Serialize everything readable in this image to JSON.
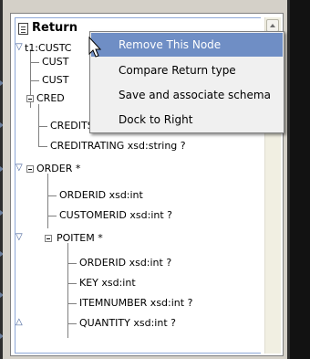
{
  "header": {
    "title": "Return",
    "icon": "document-icon"
  },
  "tree": [
    {
      "label": "t1:CUSTC",
      "expander": "glyph"
    },
    {
      "label": "CUST"
    },
    {
      "label": "CUST"
    },
    {
      "label": "CRED",
      "expander": "box"
    },
    {
      "label": "CREDITSCORE  xsd:int ?"
    },
    {
      "label": "CREDITRATING  xsd:string ?"
    },
    {
      "label": "ORDER *",
      "expander": "both"
    },
    {
      "label": "ORDERID  xsd:int"
    },
    {
      "label": "CUSTOMERID  xsd:int ?"
    },
    {
      "label": "POITEM *",
      "expander": "both"
    },
    {
      "label": "ORDERID  xsd:int ?"
    },
    {
      "label": "KEY  xsd:int"
    },
    {
      "label": "ITEMNUMBER  xsd:int ?"
    },
    {
      "label": "QUANTITY  xsd:int ?",
      "expander": "glyph"
    }
  ],
  "context_menu": {
    "items": [
      {
        "label": "Remove This Node",
        "highlighted": true
      },
      {
        "label": "Compare Return type"
      },
      {
        "label": "Save and associate schema"
      },
      {
        "label": "Dock to Right"
      }
    ]
  },
  "colors": {
    "highlight": "#6f8ec5",
    "panel_bg": "#ffffff",
    "frame": "#d4d0c8"
  }
}
